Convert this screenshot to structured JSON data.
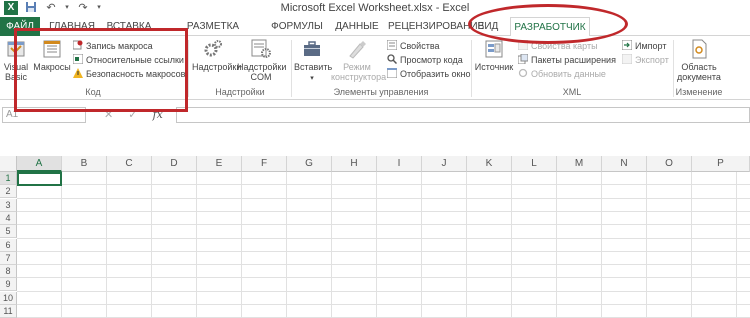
{
  "window": {
    "title": "Microsoft Excel Worksheet.xlsx - Excel",
    "app_icon": "X"
  },
  "qat": {
    "icons": [
      "save-icon",
      "undo-icon",
      "redo-icon"
    ]
  },
  "tabs": {
    "file": "ФАЙЛ",
    "home": "ГЛАВНАЯ",
    "insert": "ВСТАВКА",
    "page_layout": "РАЗМЕТКА СТРАНИЦЫ",
    "formulas": "ФОРМУЛЫ",
    "data": "ДАННЫЕ",
    "review": "РЕЦЕНЗИРОВАНИЕ",
    "view": "ВИД",
    "developer": "РАЗРАБОТЧИК"
  },
  "ribbon": {
    "code": {
      "label": "Код",
      "visual_basic": "Visual Basic",
      "macros": "Макросы",
      "record_macro": "Запись макроса",
      "relative_refs": "Относительные ссылки",
      "macro_security": "Безопасность макросов"
    },
    "addins": {
      "label": "Надстройки",
      "addins": "Надстройки",
      "com_addins_1": "Надстройки",
      "com_addins_2": "COM"
    },
    "controls": {
      "label": "Элементы управления",
      "insert": "Вставить",
      "design_mode_1": "Режим",
      "design_mode_2": "конструктора",
      "properties": "Свойства",
      "view_code": "Просмотр кода",
      "run_dialog": "Отобразить окно"
    },
    "xml": {
      "label": "XML",
      "source": "Источник",
      "map_properties": "Свойства карты",
      "expansion_packs": "Пакеты расширения",
      "refresh_data": "Обновить данные",
      "import": "Импорт",
      "export": "Экспорт"
    },
    "modify": {
      "label": "Изменение",
      "doc_panel_1": "Область",
      "doc_panel_2": "документа"
    }
  },
  "formula_bar": {
    "name_box": "A1",
    "fx": "fx",
    "value": ""
  },
  "grid": {
    "columns": [
      "A",
      "B",
      "C",
      "D",
      "E",
      "F",
      "G",
      "H",
      "I",
      "J",
      "K",
      "L",
      "M",
      "N",
      "O",
      "P"
    ],
    "rows": [
      "1",
      "2",
      "3",
      "4",
      "5",
      "6",
      "7",
      "8",
      "9",
      "10",
      "11"
    ]
  },
  "colors": {
    "excel_green": "#217346",
    "annotation_red": "#c0282b"
  }
}
